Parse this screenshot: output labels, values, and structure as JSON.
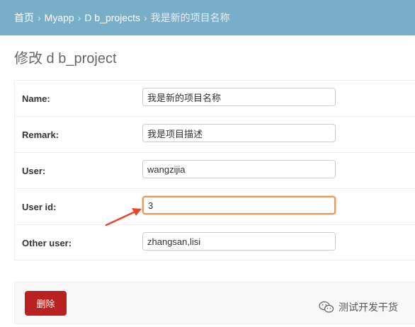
{
  "breadcrumbs": {
    "items": [
      "首页",
      "Myapp",
      "D b_projects"
    ],
    "current": "我是新的项目名称",
    "separator": "›"
  },
  "page": {
    "title": "修改 d b_project"
  },
  "form": {
    "fields": [
      {
        "label": "Name:",
        "value": "我是新的项目名称"
      },
      {
        "label": "Remark:",
        "value": "我是项目描述"
      },
      {
        "label": "User:",
        "value": "wangzijia"
      },
      {
        "label": "User id:",
        "value": "3",
        "focused": true
      },
      {
        "label": "Other user:",
        "value": "zhangsan,lisi"
      }
    ]
  },
  "actions": {
    "delete_label": "删除"
  },
  "watermark": {
    "text": "测试开发干货",
    "icon": "wechat-icon"
  },
  "colors": {
    "header_bg": "#79aec8",
    "delete_bg": "#ba2121",
    "focus_border": "#e89a5c",
    "arrow": "#e8452c"
  }
}
